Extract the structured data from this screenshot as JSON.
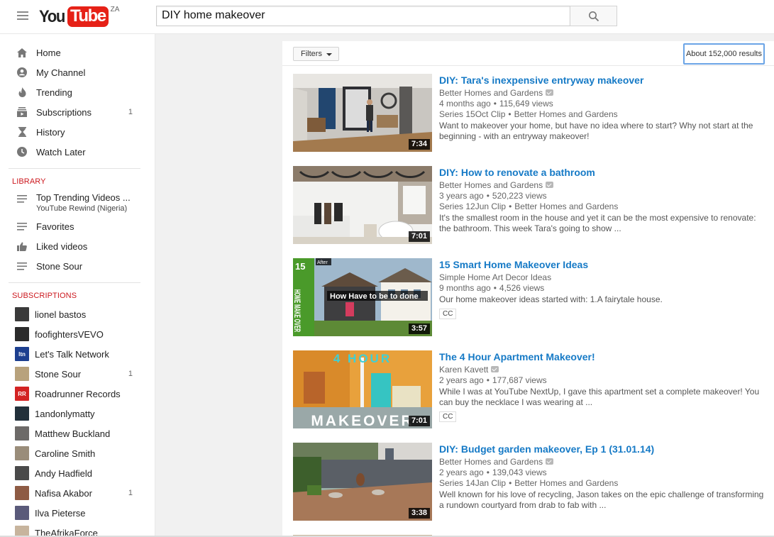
{
  "header": {
    "logo_you": "You",
    "logo_tube": "Tube",
    "logo_region": "ZA",
    "search_value": "DIY home makeover"
  },
  "sidebar": {
    "main": [
      {
        "label": "Home",
        "icon": "home-icon"
      },
      {
        "label": "My Channel",
        "icon": "account-icon"
      },
      {
        "label": "Trending",
        "icon": "flame-icon"
      },
      {
        "label": "Subscriptions",
        "icon": "subscriptions-icon",
        "count": "1"
      },
      {
        "label": "History",
        "icon": "hourglass-icon"
      },
      {
        "label": "Watch Later",
        "icon": "clock-icon"
      }
    ],
    "library_title": "LIBRARY",
    "library": [
      {
        "label": "Top Trending Videos ...",
        "sub": "YouTube Rewind (Nigeria)",
        "icon": "playlist-icon"
      },
      {
        "label": "Favorites",
        "icon": "playlist-icon"
      },
      {
        "label": "Liked videos",
        "icon": "thumbs-up-icon"
      },
      {
        "label": "Stone Sour",
        "icon": "playlist-icon"
      }
    ],
    "subscriptions_title": "SUBSCRIPTIONS",
    "subscriptions": [
      {
        "label": "lionel bastos",
        "color": "#3a3a3a"
      },
      {
        "label": "foofightersVEVO",
        "color": "#2b2b2b"
      },
      {
        "label": "Let's Talk Network",
        "color": "#1d3f8f",
        "avatar_text": "ltn"
      },
      {
        "label": "Stone Sour",
        "color": "#b8a27c",
        "count": "1"
      },
      {
        "label": "Roadrunner Records",
        "color": "#d32323",
        "avatar_text": "RR"
      },
      {
        "label": "1andonlymatty",
        "color": "#22303a"
      },
      {
        "label": "Matthew Buckland",
        "color": "#6d6a68"
      },
      {
        "label": "Caroline Smith",
        "color": "#9a8d7a"
      },
      {
        "label": "Andy Hadfield",
        "color": "#4a4a4a"
      },
      {
        "label": "Nafisa Akabor",
        "color": "#8e5b44",
        "count": "1"
      },
      {
        "label": "Ilva Pieterse",
        "color": "#5a5a7a"
      },
      {
        "label": "TheAfrikaForce",
        "color": "#c7b49d"
      }
    ]
  },
  "filters": {
    "label": "Filters",
    "results": "About 152,000 results"
  },
  "results": [
    {
      "title": "DIY: Tara's inexpensive entryway makeover",
      "channel": "Better Homes and Gardens",
      "verified": true,
      "age": "4 months ago",
      "views": "115,649 views",
      "series": "Series 15Oct Clip",
      "series_channel": "Better Homes and Gardens",
      "desc": "Want to makeover your home, but have no idea where to start? Why not start at the beginning - with an entryway makeover!",
      "duration": "7:34",
      "cc": ""
    },
    {
      "title": "DIY: How to renovate a bathroom",
      "channel": "Better Homes and Gardens",
      "verified": true,
      "age": "3 years ago",
      "views": "520,223 views",
      "series": "Series 12Jun Clip",
      "series_channel": "Better Homes and Gardens",
      "desc": "It's the smallest room in the house and yet it can be the most expensive to renovate: the bathroom. This week Tara's going to show ...",
      "duration": "7:01",
      "cc": ""
    },
    {
      "title": "15 Smart Home Makeover Ideas",
      "channel": "Simple Home Art Decor Ideas",
      "verified": false,
      "age": "9 months ago",
      "views": "4,526 views",
      "series": "",
      "series_channel": "",
      "desc": "Our home makeover ideas started with: 1.A fairytale house.",
      "duration": "3:57",
      "cc": "CC",
      "thumb_text_top": "15",
      "thumb_text_side": "HOME MAKE OVER",
      "thumb_caption": "How Have to be to done",
      "thumb_after": "After"
    },
    {
      "title": "The 4 Hour Apartment Makeover!",
      "channel": "Karen Kavett",
      "verified": true,
      "age": "2 years ago",
      "views": "177,687 views",
      "series": "",
      "series_channel": "",
      "desc": "While I was at YouTube NextUp, I gave this apartment set a complete makeover! You can buy the necklace I was wearing at ...",
      "duration": "7:01",
      "cc": "CC",
      "thumb_text_top": "4 HOUR",
      "thumb_text_bottom": "MAKEOVER"
    },
    {
      "title": "DIY: Budget garden makeover, Ep 1 (31.01.14)",
      "channel": "Better Homes and Gardens",
      "verified": true,
      "age": "2 years ago",
      "views": "139,043 views",
      "series": "Series 14Jan Clip",
      "series_channel": "Better Homes and Gardens",
      "desc": "Well known for his love of recycling, Jason takes on the epic challenge of transforming a rundown courtyard from drab to fab with ...",
      "duration": "3:38",
      "cc": ""
    }
  ]
}
